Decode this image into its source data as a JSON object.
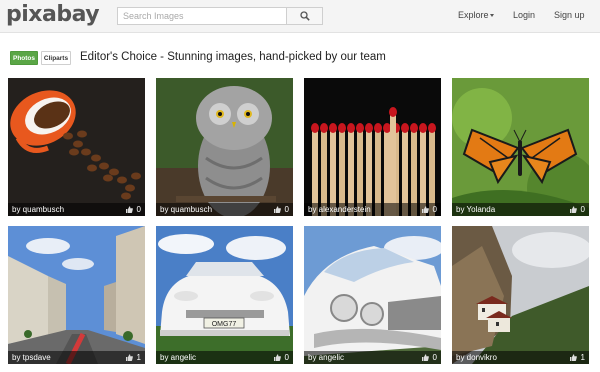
{
  "brand": {
    "logo_text": "pixabay",
    "logo_accent": "#4bc0c8"
  },
  "search": {
    "placeholder": "Search Images",
    "value": "",
    "button_icon": "search-icon"
  },
  "nav": {
    "explore": "Explore",
    "login": "Login",
    "signup": "Sign up"
  },
  "tabs": {
    "photos": "Photos",
    "cliparts": "Cliparts",
    "active": "Photos",
    "active_color": "#5aa646"
  },
  "headline": "Editor's Choice - Stunning images, hand-picked by our team",
  "images": [
    {
      "subject": "coffee beans spilling from an orange cup",
      "author": "by quambusch",
      "likes": "0"
    },
    {
      "subject": "great grey owl",
      "author": "by quambusch",
      "likes": "0"
    },
    {
      "subject": "row of matches with red heads",
      "author": "by alexanderstein",
      "likes": "0"
    },
    {
      "subject": "monarch butterfly on a leaf",
      "author": "by Yolanda",
      "likes": "0"
    },
    {
      "subject": "city street with old buildings",
      "author": "by tpsdave",
      "likes": "1"
    },
    {
      "subject": "white classic sports car front",
      "author": "by angelic",
      "likes": "0"
    },
    {
      "subject": "white classic car close-up",
      "author": "by angelic",
      "likes": "0"
    },
    {
      "subject": "monastery on a mountain cliff",
      "author": "by donvikro",
      "likes": "1"
    }
  ],
  "icons": {
    "like": "thumbs-up-icon",
    "explore_caret": "chevron-down-icon"
  }
}
